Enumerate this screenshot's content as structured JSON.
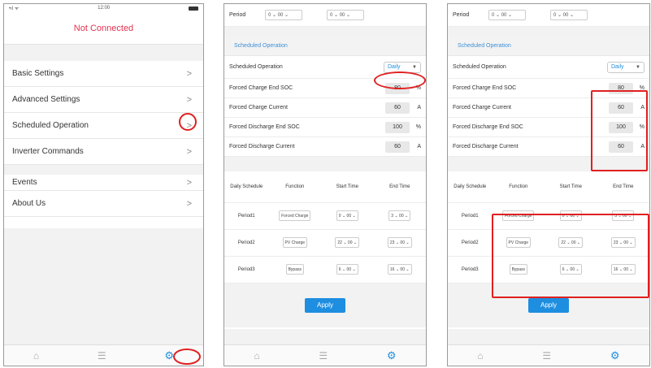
{
  "status": {
    "time": "12:00",
    "signal": "•ıl ᯤ"
  },
  "p1": {
    "title": "Not Connected",
    "menu": [
      {
        "label": "Basic Settings"
      },
      {
        "label": "Advanced Settings"
      },
      {
        "label": "Scheduled Operation"
      },
      {
        "label": "Inverter Commands"
      },
      {
        "label": "Events"
      },
      {
        "label": "About Us"
      }
    ]
  },
  "settings": {
    "period_label": "Period",
    "period_start": "0 ⌄ 00 ⌄",
    "period_end": "0 ⌄ 00 ⌄",
    "section_title": "Scheduled Operation",
    "scheduled_label": "Scheduled Operation",
    "scheduled_value": "Daily",
    "fields": [
      {
        "label": "Forced Charge End SOC",
        "value": "80",
        "unit": "%"
      },
      {
        "label": "Forced Charge Current",
        "value": "60",
        "unit": "A"
      },
      {
        "label": "Forced Discharge End SOC",
        "value": "100",
        "unit": "%"
      },
      {
        "label": "Forced Discharge Current",
        "value": "60",
        "unit": "A"
      }
    ],
    "table_headers": [
      "Daily Schedule",
      "Function",
      "Start Time",
      "End Time"
    ],
    "rows": [
      {
        "period": "Period1",
        "function": "Forced Charge",
        "start": "0 ⌄ 00 ⌄",
        "end": "3 ⌄ 00 ⌄"
      },
      {
        "period": "Period2",
        "function": "PV Charge",
        "start": "22 ⌄ 00 ⌄",
        "end": "23 ⌄ 00 ⌄"
      },
      {
        "period": "Period3",
        "function": "Bypass",
        "start": "6 ⌄ 00 ⌄",
        "end": "16 ⌄ 00 ⌄"
      }
    ],
    "apply_label": "Apply"
  },
  "icons": {
    "home": "home-icon",
    "sliders": "sliders-icon",
    "gear": "gear-icon"
  },
  "colors": {
    "accent": "#1e8ee0",
    "error": "#e4324f",
    "annotation": "#e02020"
  }
}
